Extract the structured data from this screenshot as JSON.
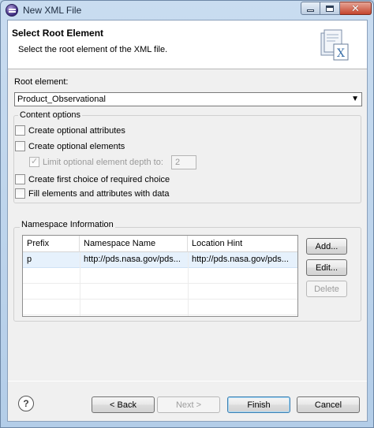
{
  "window": {
    "title": "New XML File"
  },
  "banner": {
    "title": "Select Root Element",
    "description": "Select the root element of the XML file."
  },
  "root_element": {
    "label": "Root element:",
    "value": "Product_Observational"
  },
  "content_options": {
    "label": "Content options",
    "items": [
      {
        "label": "Create optional attributes",
        "checked": false,
        "enabled": true
      },
      {
        "label": "Create optional elements",
        "checked": false,
        "enabled": true
      },
      {
        "label": "Limit optional element depth to:",
        "checked": true,
        "enabled": false
      },
      {
        "label": "Create first choice of required choice",
        "checked": false,
        "enabled": true
      },
      {
        "label": "Fill elements and attributes with data",
        "checked": false,
        "enabled": true
      }
    ],
    "depth_value": "2"
  },
  "namespace": {
    "label": "Namespace Information",
    "columns": [
      "Prefix",
      "Namespace Name",
      "Location Hint"
    ],
    "rows": [
      [
        "p",
        "http://pds.nasa.gov/pds...",
        "http://pds.nasa.gov/pds..."
      ]
    ],
    "buttons": {
      "add": "Add...",
      "edit": "Edit...",
      "delete": "Delete"
    }
  },
  "footer": {
    "back": "< Back",
    "next": "Next >",
    "finish": "Finish",
    "cancel": "Cancel",
    "help_glyph": "?"
  },
  "icons": {
    "title_icon": "eclipse-icon",
    "banner_icon": "xml-file-icon",
    "help_icon": "help-icon"
  }
}
